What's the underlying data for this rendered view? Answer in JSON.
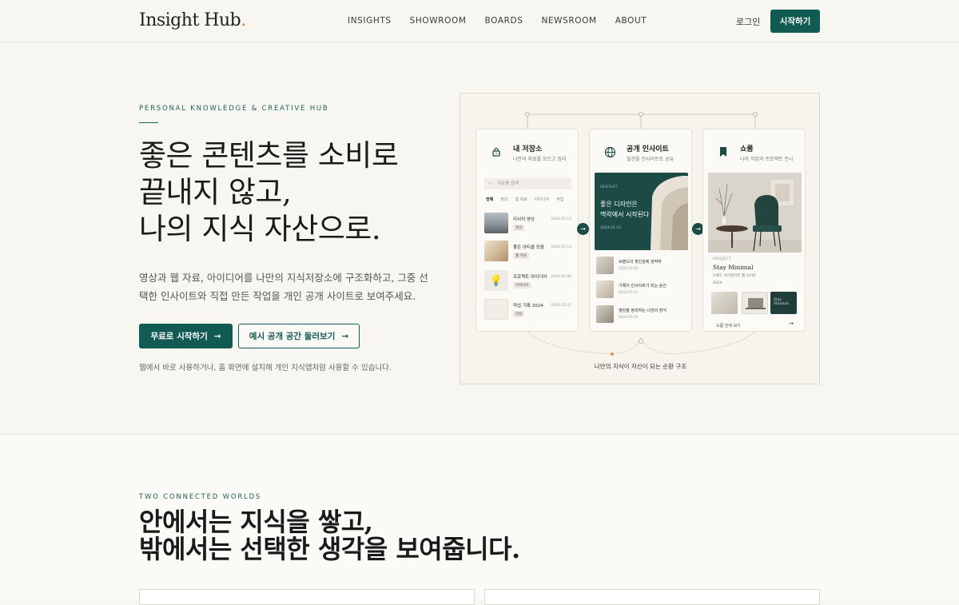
{
  "header": {
    "logo": "Insight Hub",
    "logo_dot": ".",
    "nav": [
      "INSIGHTS",
      "SHOWROOM",
      "BOARDS",
      "NEWSROOM",
      "ABOUT"
    ],
    "login": "로그인",
    "start": "시작하기"
  },
  "hero": {
    "eyebrow": "PERSONAL KNOWLEDGE & CREATIVE HUB",
    "title": [
      "좋은 콘텐츠를 소비로",
      "끝내지 않고,",
      "나의 지식 자산으로."
    ],
    "description": "영상과 웹 자료, 아이디어를 나만의 지식저장소에 구조화하고, 그중 선택한 인사이트와 직접 만든 작업을 개인 공개 사이트로 보여주세요.",
    "primary_button": "무료로 시작하기",
    "secondary_button": "예시 공개 공간 둘러보기",
    "note": "웹에서 바로 사용하거나, 홈 화면에 설치해 개인 지식앱처럼 사용할 수 있습니다."
  },
  "illustration": {
    "cards": [
      {
        "title": "내 저장소",
        "subtitle": "나만의 자료를 모으고 정리",
        "icon": "lock-icon"
      },
      {
        "title": "공개 인사이트",
        "subtitle": "발견을 인사이트로 공유",
        "icon": "globe-icon"
      },
      {
        "title": "쇼룸",
        "subtitle": "나의 작업과 프로젝트 전시",
        "icon": "bookmark-icon"
      }
    ],
    "search_placeholder": "자료를 검색",
    "filter_tabs": [
      "전체",
      "영상",
      "웹 자료",
      "아이디어",
      "작업"
    ],
    "storage_items": [
      {
        "title": "리서치 영상",
        "tag": "영상",
        "date": "2024.05.14"
      },
      {
        "title": "좋은 아티클 모음",
        "tag": "웹 자료",
        "date": "2024.05.10"
      },
      {
        "title": "프로젝트 아이디어",
        "tag": "아이디어",
        "date": "2024.05.08"
      },
      {
        "title": "작업 기록 2024",
        "tag": "작업",
        "date": "2024.05.01"
      }
    ],
    "feature": {
      "label": "INSIGHT",
      "headline": [
        "좋은 디자인은",
        "맥락에서 시작된다"
      ],
      "date": "2024.05.13"
    },
    "insight_items": [
      {
        "title": "브랜드의 첫인상에 관하여",
        "date": "2024.05.10"
      },
      {
        "title": "기록이 인사이트가 되는 순간",
        "date": "2024.05.07"
      },
      {
        "title": "영감을 정리하는 나만의 방식",
        "date": "2024.05.02"
      }
    ],
    "showroom": {
      "label": "PROJECT",
      "title": "Stay Minimal",
      "subtitle": "브랜드 아이덴티티 웹 사이트",
      "year": "2024",
      "thumb_text": "Stay Minimal",
      "all_link": "쇼룸 전체 보기"
    },
    "caption": "나만의 지식이 자산이 되는 순환 구조"
  },
  "section2": {
    "eyebrow": "TWO CONNECTED WORLDS",
    "title": [
      "안에서는 지식을 쌓고,",
      "밖에서는 선택한 생각을 보여줍니다."
    ]
  },
  "colors": {
    "accent": "#125b52",
    "background": "#f8f6f1",
    "logo_dot": "#c9832f"
  }
}
